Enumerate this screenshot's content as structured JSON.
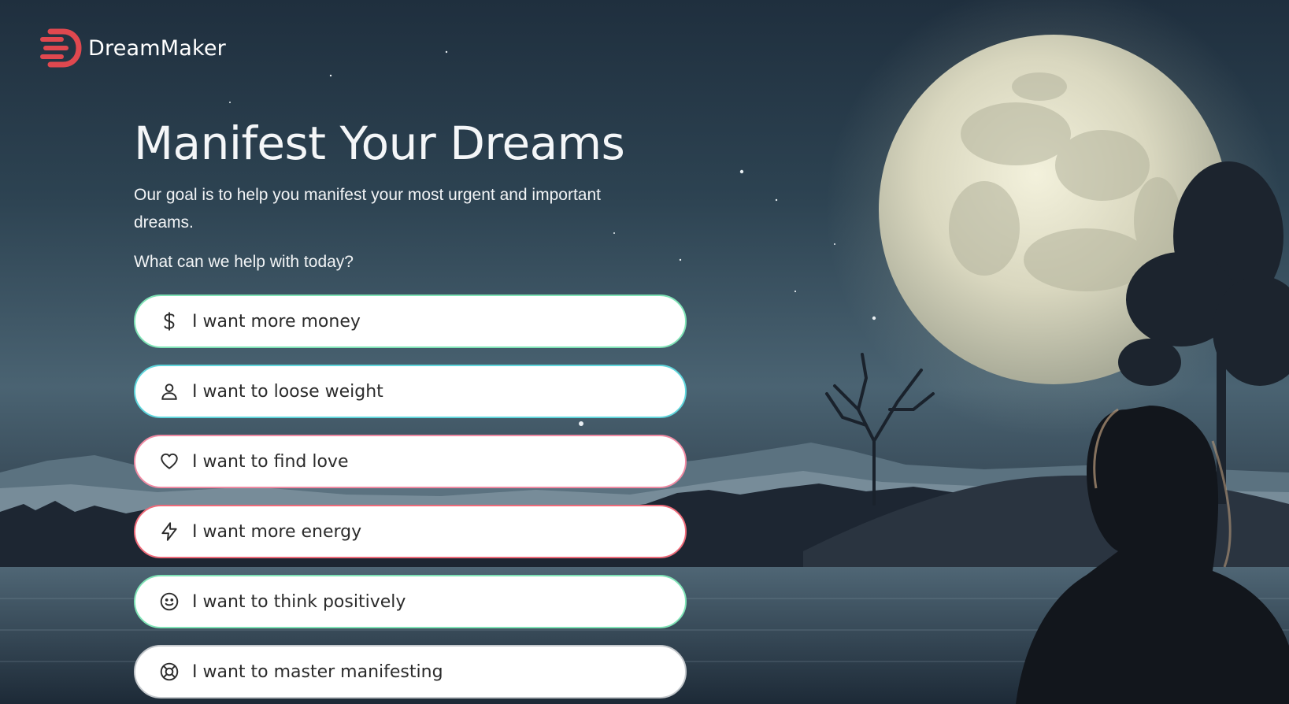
{
  "brand": {
    "name": "DreamMaker",
    "logo_color": "#e0484f"
  },
  "hero": {
    "title": "Manifest Your Dreams",
    "subtitle": "Our goal is to help you manifest your most urgent and important dreams.",
    "question": "What can we help with today?"
  },
  "options": [
    {
      "label": "I want more money",
      "icon": "dollar-icon",
      "border": "#7fe3b6"
    },
    {
      "label": "I want to loose weight",
      "icon": "person-icon",
      "border": "#5fd6dc"
    },
    {
      "label": "I want to find love",
      "icon": "heart-icon",
      "border": "#f08aa3"
    },
    {
      "label": "I want more energy",
      "icon": "lightning-icon",
      "border": "#ee6a79"
    },
    {
      "label": "I want to think positively",
      "icon": "smiley-icon",
      "border": "#7fe3b6"
    },
    {
      "label": "I want to master manifesting",
      "icon": "lifebuoy-icon",
      "border": "#c4c8cc"
    }
  ]
}
